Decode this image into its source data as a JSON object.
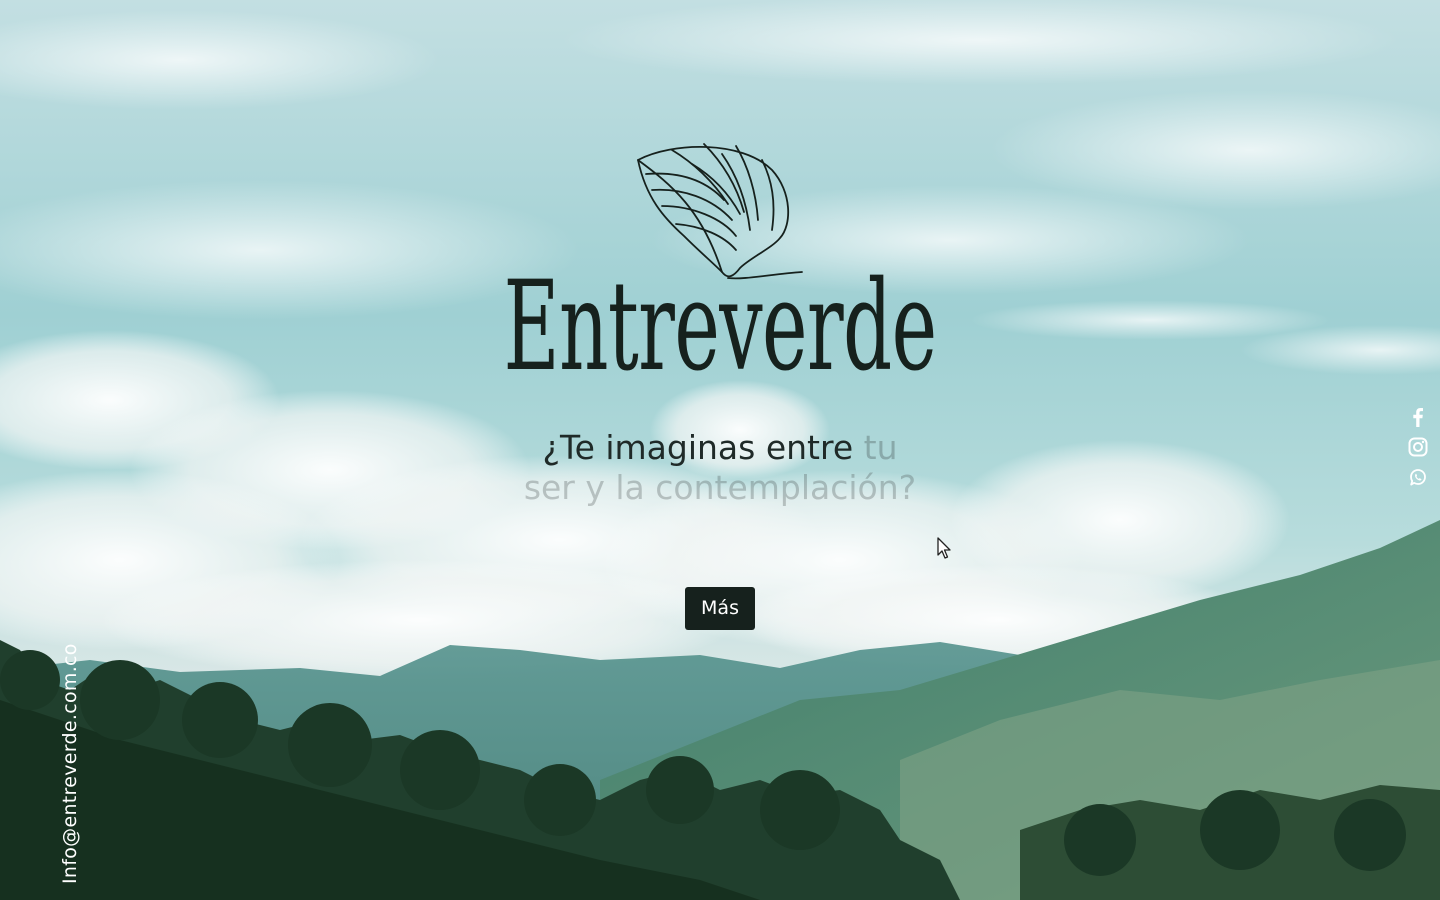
{
  "brand": {
    "name": "Entreverde",
    "logo_icon": "leaf-icon"
  },
  "hero": {
    "tagline_main": "¿Te imaginas entre ",
    "tagline_fade_1": "tu",
    "tagline_fade_2": "ser y la contemplación?",
    "button_label": "Más"
  },
  "social": [
    {
      "icon": "facebook-icon"
    },
    {
      "icon": "instagram-icon"
    },
    {
      "icon": "whatsapp-icon"
    }
  ],
  "contact": {
    "email": "Info@entreverde.com.co"
  },
  "colors": {
    "brand_dark": "#16211d",
    "sky_top": "#b9d9dd",
    "sky_mid": "#8fcbcf",
    "mountain": "#4f8d8a",
    "forest": "#1f3d2c"
  }
}
